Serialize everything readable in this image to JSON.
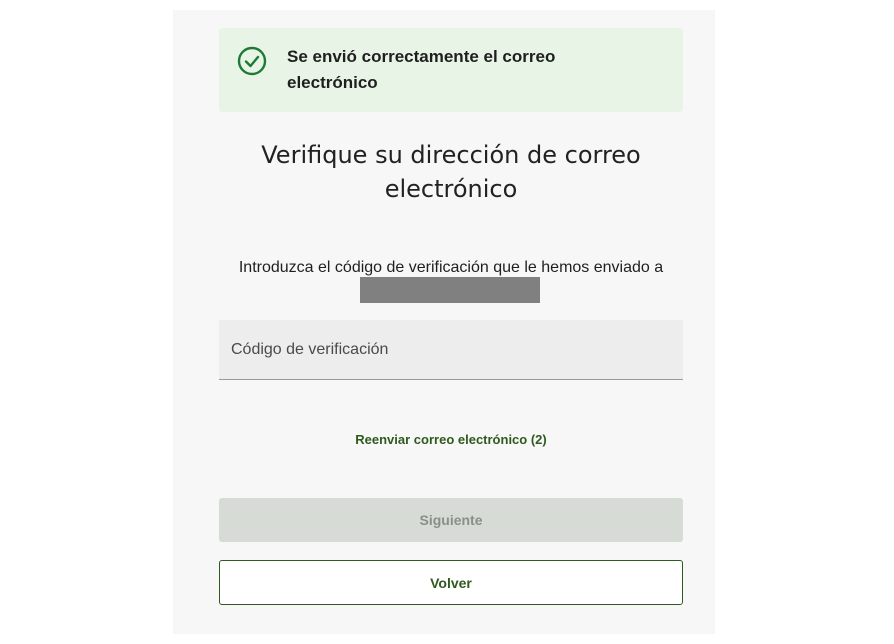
{
  "alert": {
    "icon": "check-circle-icon",
    "message": "Se envió correctamente el correo electrónico",
    "color": "#1e7a34",
    "background": "#e8f5e6"
  },
  "main": {
    "title": "Verifique su dirección de correo electrónico",
    "instructions": "Introduzca el código de verificación que le hemos enviado a"
  },
  "code_field": {
    "placeholder": "Código de verificación",
    "value": ""
  },
  "resend_link": {
    "label": "Reenviar correo electrónico (2)"
  },
  "buttons": {
    "next_label": "Siguiente",
    "back_label": "Volver"
  },
  "colors": {
    "accent": "#2f5a1f",
    "disabled_bg": "#d7dbd6",
    "disabled_text": "#8a8f89",
    "redaction": "#808080"
  }
}
